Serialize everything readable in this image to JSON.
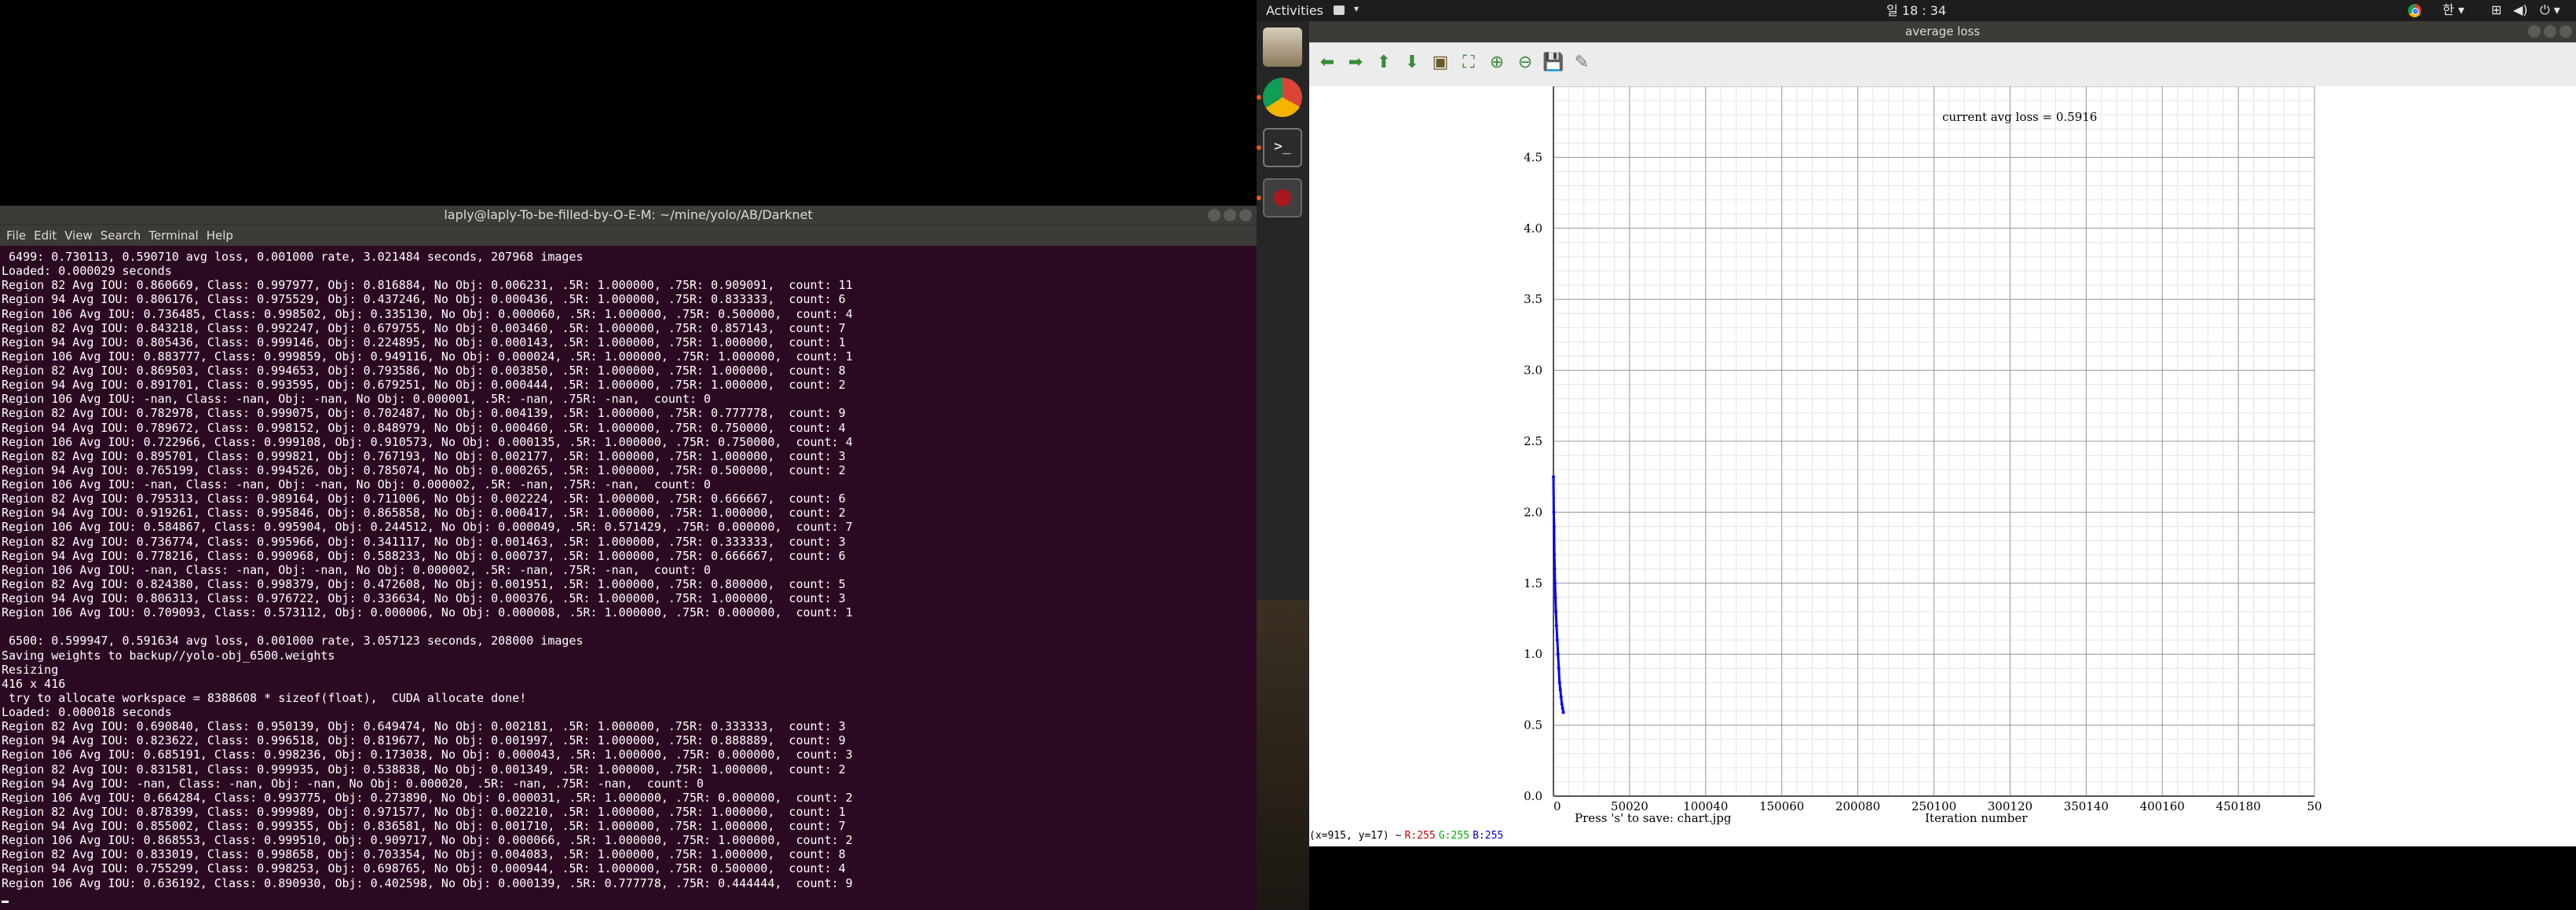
{
  "terminal": {
    "title": "laply@laply-To-be-filled-by-O-E-M: ~/mine/yolo/AB/Darknet",
    "menu": [
      "File",
      "Edit",
      "View",
      "Search",
      "Terminal",
      "Help"
    ],
    "lines": [
      " 6499: 0.730113, 0.590710 avg loss, 0.001000 rate, 3.021484 seconds, 207968 images",
      "Loaded: 0.000029 seconds",
      "Region 82 Avg IOU: 0.860669, Class: 0.997977, Obj: 0.816884, No Obj: 0.006231, .5R: 1.000000, .75R: 0.909091,  count: 11",
      "Region 94 Avg IOU: 0.806176, Class: 0.975529, Obj: 0.437246, No Obj: 0.000436, .5R: 1.000000, .75R: 0.833333,  count: 6",
      "Region 106 Avg IOU: 0.736485, Class: 0.998502, Obj: 0.335130, No Obj: 0.000060, .5R: 1.000000, .75R: 0.500000,  count: 4",
      "Region 82 Avg IOU: 0.843218, Class: 0.992247, Obj: 0.679755, No Obj: 0.003460, .5R: 1.000000, .75R: 0.857143,  count: 7",
      "Region 94 Avg IOU: 0.805436, Class: 0.999146, Obj: 0.224895, No Obj: 0.000143, .5R: 1.000000, .75R: 1.000000,  count: 1",
      "Region 106 Avg IOU: 0.883777, Class: 0.999859, Obj: 0.949116, No Obj: 0.000024, .5R: 1.000000, .75R: 1.000000,  count: 1",
      "Region 82 Avg IOU: 0.869503, Class: 0.994653, Obj: 0.793586, No Obj: 0.003850, .5R: 1.000000, .75R: 1.000000,  count: 8",
      "Region 94 Avg IOU: 0.891701, Class: 0.993595, Obj: 0.679251, No Obj: 0.000444, .5R: 1.000000, .75R: 1.000000,  count: 2",
      "Region 106 Avg IOU: -nan, Class: -nan, Obj: -nan, No Obj: 0.000001, .5R: -nan, .75R: -nan,  count: 0",
      "Region 82 Avg IOU: 0.782978, Class: 0.999075, Obj: 0.702487, No Obj: 0.004139, .5R: 1.000000, .75R: 0.777778,  count: 9",
      "Region 94 Avg IOU: 0.789672, Class: 0.998152, Obj: 0.848979, No Obj: 0.000460, .5R: 1.000000, .75R: 0.750000,  count: 4",
      "Region 106 Avg IOU: 0.722966, Class: 0.999108, Obj: 0.910573, No Obj: 0.000135, .5R: 1.000000, .75R: 0.750000,  count: 4",
      "Region 82 Avg IOU: 0.895701, Class: 0.999821, Obj: 0.767193, No Obj: 0.002177, .5R: 1.000000, .75R: 1.000000,  count: 3",
      "Region 94 Avg IOU: 0.765199, Class: 0.994526, Obj: 0.785074, No Obj: 0.000265, .5R: 1.000000, .75R: 0.500000,  count: 2",
      "Region 106 Avg IOU: -nan, Class: -nan, Obj: -nan, No Obj: 0.000002, .5R: -nan, .75R: -nan,  count: 0",
      "Region 82 Avg IOU: 0.795313, Class: 0.989164, Obj: 0.711006, No Obj: 0.002224, .5R: 1.000000, .75R: 0.666667,  count: 6",
      "Region 94 Avg IOU: 0.919261, Class: 0.995846, Obj: 0.865858, No Obj: 0.000417, .5R: 1.000000, .75R: 1.000000,  count: 2",
      "Region 106 Avg IOU: 0.584867, Class: 0.995904, Obj: 0.244512, No Obj: 0.000049, .5R: 0.571429, .75R: 0.000000,  count: 7",
      "Region 82 Avg IOU: 0.736774, Class: 0.995966, Obj: 0.341117, No Obj: 0.001463, .5R: 1.000000, .75R: 0.333333,  count: 3",
      "Region 94 Avg IOU: 0.778216, Class: 0.990968, Obj: 0.588233, No Obj: 0.000737, .5R: 1.000000, .75R: 0.666667,  count: 6",
      "Region 106 Avg IOU: -nan, Class: -nan, Obj: -nan, No Obj: 0.000002, .5R: -nan, .75R: -nan,  count: 0",
      "Region 82 Avg IOU: 0.824380, Class: 0.998379, Obj: 0.472608, No Obj: 0.001951, .5R: 1.000000, .75R: 0.800000,  count: 5",
      "Region 94 Avg IOU: 0.806313, Class: 0.976722, Obj: 0.336634, No Obj: 0.000376, .5R: 1.000000, .75R: 1.000000,  count: 3",
      "Region 106 Avg IOU: 0.709093, Class: 0.573112, Obj: 0.000006, No Obj: 0.000008, .5R: 1.000000, .75R: 0.000000,  count: 1",
      "",
      " 6500: 0.599947, 0.591634 avg loss, 0.001000 rate, 3.057123 seconds, 208000 images",
      "Saving weights to backup//yolo-obj_6500.weights",
      "Resizing",
      "416 x 416",
      " try to allocate workspace = 8388608 * sizeof(float),  CUDA allocate done!",
      "Loaded: 0.000018 seconds",
      "Region 82 Avg IOU: 0.690840, Class: 0.950139, Obj: 0.649474, No Obj: 0.002181, .5R: 1.000000, .75R: 0.333333,  count: 3",
      "Region 94 Avg IOU: 0.823622, Class: 0.996518, Obj: 0.819677, No Obj: 0.001997, .5R: 1.000000, .75R: 0.888889,  count: 9",
      "Region 106 Avg IOU: 0.685191, Class: 0.998236, Obj: 0.173038, No Obj: 0.000043, .5R: 1.000000, .75R: 0.000000,  count: 3",
      "Region 82 Avg IOU: 0.831581, Class: 0.999935, Obj: 0.538838, No Obj: 0.001349, .5R: 1.000000, .75R: 1.000000,  count: 2",
      "Region 94 Avg IOU: -nan, Class: -nan, Obj: -nan, No Obj: 0.000020, .5R: -nan, .75R: -nan,  count: 0",
      "Region 106 Avg IOU: 0.664284, Class: 0.993775, Obj: 0.273890, No Obj: 0.000031, .5R: 1.000000, .75R: 0.000000,  count: 2",
      "Region 82 Avg IOU: 0.878399, Class: 0.999989, Obj: 0.971577, No Obj: 0.002210, .5R: 1.000000, .75R: 1.000000,  count: 1",
      "Region 94 Avg IOU: 0.855002, Class: 0.999355, Obj: 0.836581, No Obj: 0.001710, .5R: 1.000000, .75R: 1.000000,  count: 7",
      "Region 106 Avg IOU: 0.868553, Class: 0.999510, Obj: 0.909717, No Obj: 0.000066, .5R: 1.000000, .75R: 1.000000,  count: 2",
      "Region 82 Avg IOU: 0.833019, Class: 0.998658, Obj: 0.703354, No Obj: 0.004083, .5R: 1.000000, .75R: 1.000000,  count: 8",
      "Region 94 Avg IOU: 0.755299, Class: 0.998253, Obj: 0.698765, No Obj: 0.000944, .5R: 1.000000, .75R: 0.500000,  count: 4",
      "Region 106 Avg IOU: 0.636192, Class: 0.890930, Obj: 0.402598, No Obj: 0.000139, .5R: 0.777778, .75R: 0.444444,  count: 9"
    ]
  },
  "topbar": {
    "activities": "Activities",
    "clock": "일 18 : 34",
    "input_method": "한",
    "tray_icons": [
      "chrome-icon",
      "network-icon",
      "volume-icon",
      "power-icon"
    ]
  },
  "dock": {
    "items": [
      "files-icon",
      "chrome-icon",
      "terminal-icon",
      "image-viewer-icon"
    ],
    "apps_grid": "show-applications-icon"
  },
  "chart_window": {
    "title": "average loss",
    "toolbar": [
      "arrow-left-icon",
      "arrow-right-icon",
      "arrow-up-icon",
      "arrow-down-icon",
      "save-image-icon",
      "fit-window-icon",
      "zoom-in-icon",
      "zoom-out-icon",
      "save-icon",
      "properties-icon"
    ],
    "status": {
      "coords": "(x=915, y=17) ~",
      "r": "R:255",
      "g": "G:255",
      "b": "B:255",
      "r_color": "#cc0000",
      "g_color": "#00aa00",
      "b_color": "#0000cc"
    }
  },
  "chart_data": {
    "type": "line",
    "annotation": "current avg loss = 0.5916",
    "save_hint": "Press 's' to save: chart.jpg",
    "xlabel": "Iteration number",
    "ylabel": "",
    "xlim": [
      0,
      500000
    ],
    "ylim": [
      0,
      5.0
    ],
    "x_ticks": [
      "0",
      "50020",
      "100040",
      "150060",
      "200080",
      "250100",
      "300120",
      "350140",
      "400160",
      "450180",
      "50"
    ],
    "y_ticks": [
      "0.0",
      "0.5",
      "1.0",
      "1.5",
      "2.0",
      "2.5",
      "3.0",
      "3.5",
      "4.0",
      "4.5"
    ],
    "grid": true,
    "series_color": "#0000ff",
    "series": [
      {
        "x": [
          0,
          200,
          400,
          600,
          800,
          1000,
          1300,
          1600,
          2000,
          2500,
          3000,
          3500,
          4000,
          4500,
          5000,
          5500,
          6000,
          6500
        ],
        "values": [
          2.25,
          2.0,
          1.9,
          1.7,
          1.6,
          1.5,
          1.4,
          1.3,
          1.2,
          1.1,
          1.0,
          0.9,
          0.8,
          0.75,
          0.7,
          0.65,
          0.62,
          0.59
        ]
      }
    ]
  }
}
